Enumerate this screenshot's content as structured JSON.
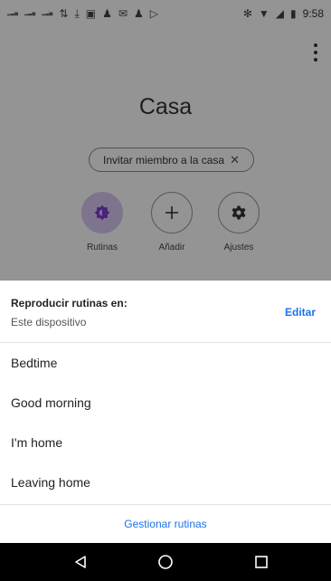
{
  "status_bar": {
    "time": "9:58",
    "left_icons": [
      "signal-icon",
      "signal-icon",
      "signal-icon",
      "data-transfer-icon",
      "download-icon",
      "image-icon",
      "person-icon",
      "mail-icon",
      "person-icon",
      "play-store-icon"
    ],
    "right_icons": [
      "bluetooth-icon",
      "wifi-icon",
      "signal-icon",
      "battery-icon"
    ]
  },
  "background": {
    "home_name": "Casa",
    "invite_chip": "Invitar miembro a la casa",
    "actions": [
      {
        "label": "Rutinas",
        "icon": "routines-icon"
      },
      {
        "label": "Añadir",
        "icon": "add-icon"
      },
      {
        "label": "Ajustes",
        "icon": "gear-icon"
      }
    ]
  },
  "sheet": {
    "title": "Reproducir rutinas en:",
    "device": "Este dispositivo",
    "edit_label": "Editar",
    "routines": [
      "Bedtime",
      "Good morning",
      "I'm home",
      "Leaving home"
    ],
    "manage_label": "Gestionar rutinas"
  },
  "navigation": {
    "buttons": [
      "back-icon",
      "home-icon",
      "recents-icon"
    ]
  },
  "colors": {
    "accent": "#1a73e8",
    "routines_chip": "#d9c9f4",
    "routines_icon": "#7b3bd0",
    "nav_bar": "#000000"
  }
}
